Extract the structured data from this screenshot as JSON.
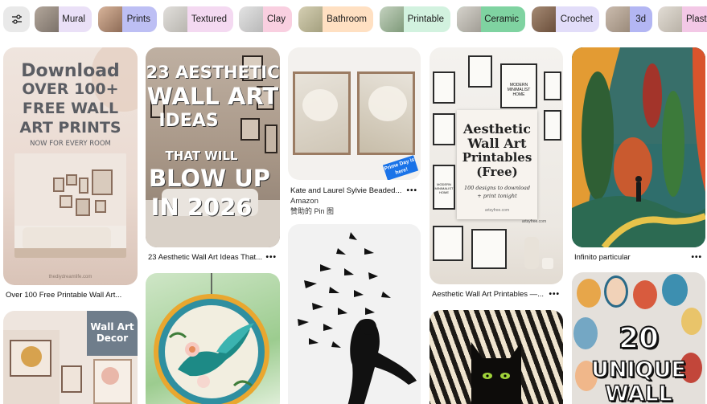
{
  "chips": [
    {
      "label": "Mural",
      "bg": "#eae0f7",
      "thumb": "#9a8f86"
    },
    {
      "label": "Prints",
      "bg": "#bdbff4",
      "thumb": "#c7a48c"
    },
    {
      "label": "Textured",
      "bg": "#f4d9f1",
      "thumb": "#d2d0cc"
    },
    {
      "label": "Clay",
      "bg": "#f9cfe0",
      "thumb": "#cfcfcf"
    },
    {
      "label": "Bathroom",
      "bg": "#ffe0c2",
      "thumb": "#c7c1a2"
    },
    {
      "label": "Printable",
      "bg": "#d2f2df",
      "thumb": "#9fb39c"
    },
    {
      "label": "Ceramic",
      "bg": "#7fd3a1",
      "thumb": "#bdbab4"
    },
    {
      "label": "Crochet",
      "bg": "#e2ddf9",
      "thumb": "#8a6c57"
    },
    {
      "label": "3d",
      "bg": "#b3b6f3",
      "thumb": "#b8a898"
    },
    {
      "label": "Plast",
      "bg": "#f3c8e6",
      "thumb": "#d6d0c7"
    }
  ],
  "pins": {
    "p1": {
      "line1": "Download",
      "line2": "OVER 100+",
      "line3": "FREE WALL",
      "line4": "ART PRINTS",
      "line5": "NOW FOR EVERY ROOM",
      "footer": "thediydreamlife.com",
      "caption": "Over 100 Free Printable Wall Art..."
    },
    "p2": {
      "line1": "23 AESTHETIC",
      "line2": "WALL ART",
      "line3": "IDEAS",
      "line4": "THAT WILL",
      "line5": "BLOW UP",
      "line6": "IN 2026",
      "caption": "23 Aesthetic Wall Art Ideas That..."
    },
    "p3": {
      "badge": "Prime Day is here!",
      "caption": "Kate and Laurel Sylvie Beaded...",
      "source": "Amazon",
      "note": "赞助的 Pin 图"
    },
    "p4": {
      "frame_a": "MODERN MINIMALIST HOME",
      "frame_b": "MODERN MINIMALIST HOME",
      "title1": "Aesthetic",
      "title2": "Wall Art",
      "title3": "Printables",
      "title4": "(Free)",
      "sub1": "100 designs to download",
      "sub2": "+ print tonight",
      "site": "artsyfree.com",
      "site2": "artsyfree.com",
      "caption": "Aesthetic Wall Art Printables —..."
    },
    "p5": {
      "caption": "Infinito particular"
    },
    "p6": {
      "line1": "Wall Art",
      "line2": "Decor"
    },
    "p8": {
      "line1": "20",
      "line2": "UNIQUE",
      "line3": "WALL"
    },
    "more": "•••"
  },
  "colors": {
    "caption": "#111111",
    "badge": "#1a73e8"
  }
}
